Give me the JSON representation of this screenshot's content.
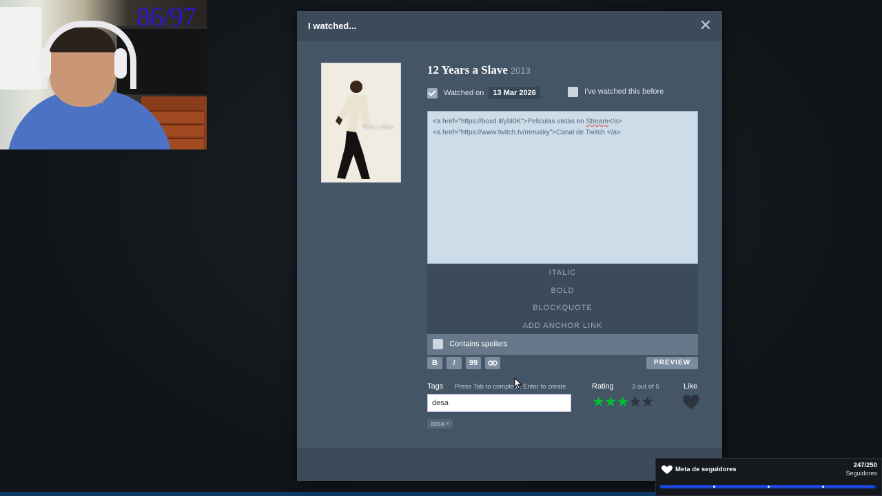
{
  "webcam": {
    "counter": "86/97"
  },
  "modal": {
    "title": "I watched...",
    "close_icon": "close-icon"
  },
  "film": {
    "title": "12 Years a Slave",
    "year": "2013",
    "poster_text": "Years a Slave"
  },
  "watched": {
    "checked": true,
    "label": "Watched on",
    "date": "13 Mar 2026",
    "rewatch_label": "I've watched this before",
    "rewatch_checked": false
  },
  "review": {
    "line1_pre": "<a href=\"https://boxd.it/ybl0K\">Peliculas vistas en ",
    "line1_misspelled": "Stream",
    "line1_post": "</a>",
    "line2": "<a href=\"https://www.twitch.tv/mrruaky\">Canal de Twitch </a>"
  },
  "format_menu": {
    "items": [
      "ITALIC",
      "BOLD",
      "BLOCKQUOTE",
      "ADD ANCHOR LINK"
    ]
  },
  "spoilers": {
    "label": "Contains spoilers",
    "checked": false
  },
  "toolbar": {
    "bold": "B",
    "italic": "I",
    "quote": "99",
    "link_icon": "link-icon",
    "preview": "PREVIEW"
  },
  "tags": {
    "label": "Tags",
    "hint": "Press Tab to complete, Enter to create",
    "input_value": "desa",
    "chips": [
      "desa"
    ]
  },
  "rating": {
    "label": "Rating",
    "value_text": "3 out of 5",
    "stars": 3,
    "max": 5,
    "active_color": "#00c030",
    "inactive_color": "#2c3440"
  },
  "like": {
    "label": "Like",
    "liked": false
  },
  "follower_goal": {
    "label": "Meta de seguidores",
    "count": "247/250",
    "sub": "Seguidores",
    "progress": 0.988
  }
}
